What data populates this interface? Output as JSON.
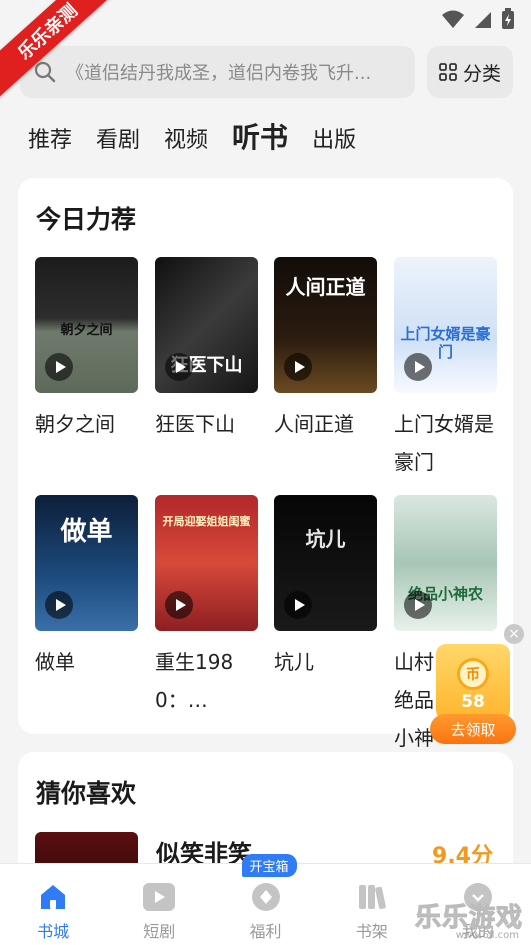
{
  "corner_label": "乐乐亲测",
  "search": {
    "placeholder": "《道侣结丹我成圣，道侣内卷我飞升...",
    "category_label": "分类"
  },
  "tabs": [
    {
      "label": "推荐",
      "active": false
    },
    {
      "label": "看剧",
      "active": false
    },
    {
      "label": "视频",
      "active": false
    },
    {
      "label": "听书",
      "active": true
    },
    {
      "label": "出版",
      "active": false
    }
  ],
  "today": {
    "title": "今日力荐",
    "books": [
      {
        "title": "朝夕之间",
        "cover_text": "朝夕之间"
      },
      {
        "title": "狂医下山",
        "cover_text": "狂医下山"
      },
      {
        "title": "人间正道",
        "cover_text": "人间正道"
      },
      {
        "title": "上门女婿是豪门",
        "cover_text": "上门女婿是豪门"
      },
      {
        "title": "做单",
        "cover_text": "做单"
      },
      {
        "title": "重生1980：…",
        "cover_text": "开局迎娶姐姐闺蜜"
      },
      {
        "title": "坑儿",
        "cover_text": "坑儿"
      },
      {
        "title": "山村绝品小神农",
        "cover_text": "绝品小神农"
      }
    ]
  },
  "reward": {
    "count": "58",
    "coin_label": "币",
    "button_label": "去领取"
  },
  "guess": {
    "title": "猜你喜欢",
    "item_title": "似笑非笑",
    "item_score": "9.4分"
  },
  "bottom_nav": [
    {
      "label": "书城",
      "icon": "home-icon",
      "active": true
    },
    {
      "label": "短剧",
      "icon": "play-icon",
      "active": false
    },
    {
      "label": "福利",
      "icon": "gift-icon",
      "active": false,
      "badge": "开宝箱"
    },
    {
      "label": "书架",
      "icon": "bookshelf-icon",
      "active": false
    },
    {
      "label": "我的",
      "icon": "profile-icon",
      "active": false
    }
  ],
  "watermark": {
    "text": "乐乐游戏",
    "url": "www.6ll.com"
  },
  "colors": {
    "accent": "#2f7cf6",
    "score": "#f19a1f",
    "ribbon": "#e0201f"
  }
}
